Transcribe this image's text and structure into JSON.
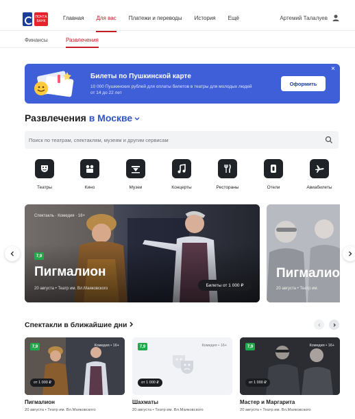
{
  "header": {
    "logo_text": "ПОЧТА БАНК",
    "nav": [
      "Главная",
      "Для вас",
      "Платежи и переводы",
      "История",
      "Ещё"
    ],
    "active_nav": 1,
    "user_name": "Артемий Талалуев"
  },
  "subnav": {
    "items": [
      "Финансы",
      "Развлечения"
    ],
    "active": 1
  },
  "banner": {
    "title": "Билеты по Пушкинской карте",
    "text": "10 000 Пушкинских рублей для оплаты билетов в театры для молодых людей от 14 до 22 лет",
    "button": "Оформить",
    "color": "#3f5fd8"
  },
  "section": {
    "title_prefix": "Развлечения",
    "city": "в Москве"
  },
  "search": {
    "placeholder": "Поиск по театрам, спектаклям, музеям и другим сервисам"
  },
  "categories": [
    {
      "label": "Театры",
      "icon": "theater-icon"
    },
    {
      "label": "Кино",
      "icon": "cinema-icon"
    },
    {
      "label": "Музеи",
      "icon": "museum-icon"
    },
    {
      "label": "Концерты",
      "icon": "music-note-icon"
    },
    {
      "label": "Рестораны",
      "icon": "fork-knife-icon"
    },
    {
      "label": "Отели",
      "icon": "hotel-icon"
    },
    {
      "label": "Авиабилеты",
      "icon": "airplane-icon"
    }
  ],
  "hero": {
    "tag": "Спектакль · Комедия · 16+",
    "rating": "7,9",
    "title": "Пигмалион",
    "subtitle": "20 августа • Театр им. Вл.Маяковского",
    "button": "Билеты от 1 000 ₽"
  },
  "hero2": {
    "title": "Пигмалион",
    "subtitle": "20 августа • Театр им."
  },
  "upcoming": {
    "title": "Спектакли в ближайшие дни",
    "cards": [
      {
        "rating": "7,9",
        "genre": "Комедия • 16+",
        "price": "от 1 000 ₽",
        "name": "Пигмалион",
        "venue": "20 августа • Театр им. Вл.Маяковского"
      },
      {
        "rating": "7,9",
        "genre": "Комедия • 16+",
        "price": "от 1 000 ₽",
        "name": "Шахматы",
        "venue": "20 августа • Театр им. Вл.Маяковского"
      },
      {
        "rating": "7,9",
        "genre": "Комедия • 16+",
        "price": "от 1 000 ₽",
        "name": "Мастер и Маргарита",
        "venue": "20 августа • Театр им. Вл.Маяковского"
      }
    ]
  }
}
